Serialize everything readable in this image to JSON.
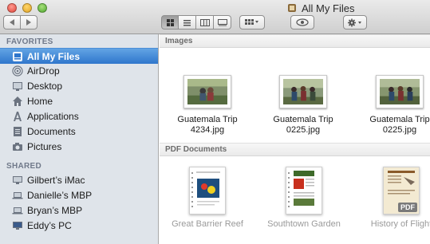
{
  "window": {
    "title": "All My Files"
  },
  "toolbar": {
    "back_icon": "back-arrow-icon",
    "forward_icon": "forward-arrow-icon",
    "view_modes": [
      "icon-view",
      "list-view",
      "column-view",
      "coverflow-view"
    ],
    "arrange_icon": "arrange-grid-icon",
    "quicklook_icon": "eye-icon",
    "action_icon": "gear-icon"
  },
  "sidebar": {
    "favorites_header": "FAVORITES",
    "favorites": [
      {
        "label": "All My Files",
        "icon": "all-files-icon",
        "selected": true
      },
      {
        "label": "AirDrop",
        "icon": "airdrop-icon"
      },
      {
        "label": "Desktop",
        "icon": "desktop-icon"
      },
      {
        "label": "Home",
        "icon": "home-icon"
      },
      {
        "label": "Applications",
        "icon": "applications-icon"
      },
      {
        "label": "Documents",
        "icon": "documents-icon"
      },
      {
        "label": "Pictures",
        "icon": "camera-icon"
      }
    ],
    "shared_header": "SHARED",
    "shared": [
      {
        "label": "Gilbert’s iMac",
        "icon": "imac-icon"
      },
      {
        "label": "Danielle’s MBP",
        "icon": "laptop-icon"
      },
      {
        "label": "Bryan’s MBP",
        "icon": "laptop-icon"
      },
      {
        "label": "Eddy’s PC",
        "icon": "pc-icon"
      }
    ]
  },
  "main": {
    "groups": [
      {
        "header": "Images",
        "files": [
          {
            "name_line1": "Guatemala Trip",
            "name_line2": "4234.jpg"
          },
          {
            "name_line1": "Guatemala Trip",
            "name_line2": "0225.jpg"
          },
          {
            "name_line1": "Guatemala Trip",
            "name_line2": "0225.jpg"
          }
        ]
      },
      {
        "header": "PDF Documents",
        "files": [
          {
            "name": "Great Barrier Reef"
          },
          {
            "name": "Southtown Garden"
          },
          {
            "name": "History of Flight",
            "badge": "PDF"
          }
        ]
      }
    ]
  },
  "colors": {
    "sidebar_bg": "#dfe4ea",
    "selection": "#3f86d6",
    "section_header": "#70798a"
  }
}
